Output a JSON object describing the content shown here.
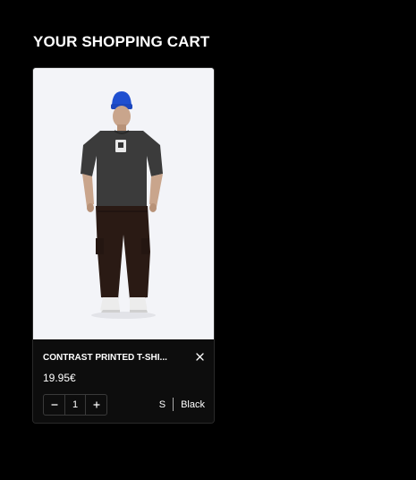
{
  "page": {
    "title": "YOUR SHOPPING CART"
  },
  "cart": {
    "items": [
      {
        "name": "CONTRAST PRINTED T-SHI...",
        "price": "19.95€",
        "quantity": "1",
        "size": "S",
        "color": "Black",
        "image": {
          "semantic": "model-photo",
          "background": "#f3f4f8",
          "beanie_color": "#1f4fd0",
          "shirt_color": "#3b3b3b",
          "pants_color": "#2a1a14"
        }
      }
    ],
    "icons": {
      "remove": "close-icon",
      "decrement": "minus-icon",
      "increment": "plus-icon"
    }
  }
}
